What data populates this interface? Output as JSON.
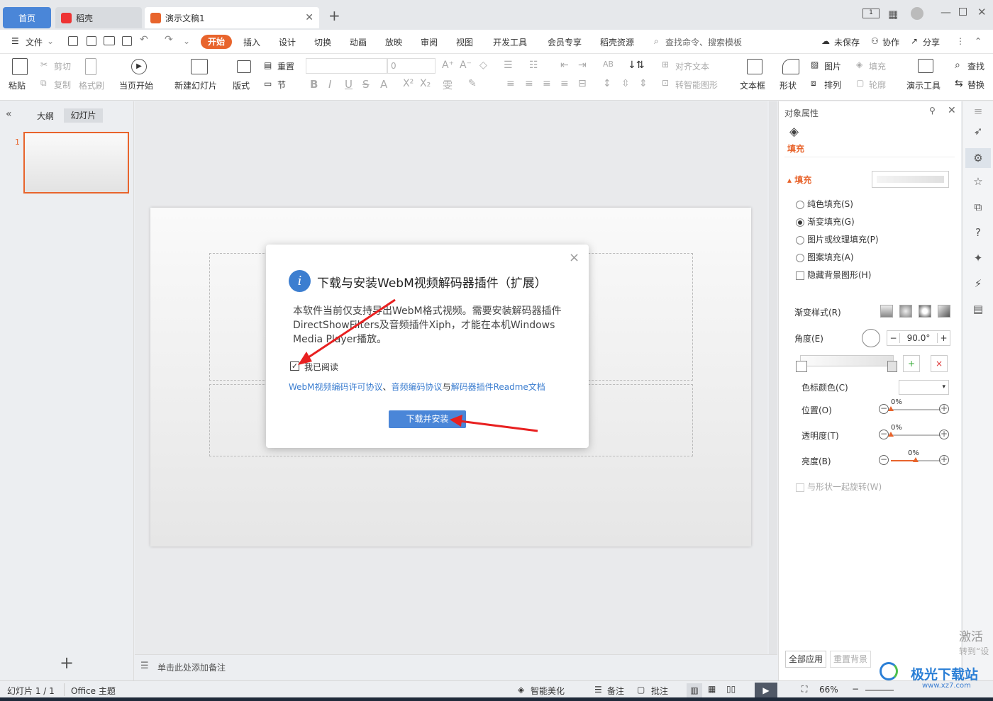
{
  "tabs": {
    "home": "首页",
    "docer": "稻壳",
    "document": "演示文稿1",
    "new_tab": "+"
  },
  "menu": {
    "file": "文件",
    "items": [
      "开始",
      "插入",
      "设计",
      "切换",
      "动画",
      "放映",
      "审阅",
      "视图",
      "开发工具",
      "会员专享",
      "稻壳资源"
    ],
    "search": "查找命令、搜索模板",
    "unsaved": "未保存",
    "collaborate": "协作",
    "share": "分享"
  },
  "toolbar": {
    "paste": "粘贴",
    "cut": "剪切",
    "copy": "复制",
    "format_painter": "格式刷",
    "from_current": "当页开始",
    "new_slide": "新建幻灯片",
    "layout": "版式",
    "reset": "重置",
    "section": "节",
    "font_size": "0",
    "align_text": "对齐文本",
    "smart_shape": "转智能图形",
    "textbox": "文本框",
    "shape": "形状",
    "picture": "图片",
    "fill": "填充",
    "arrange": "排列",
    "outline": "轮廓",
    "presenter_tools": "演示工具",
    "find": "查找",
    "replace": "替换"
  },
  "left_panel": {
    "outline_tab": "大纲",
    "slides_tab": "幻灯片",
    "slide_number": "1",
    "add": "+"
  },
  "notes": "单击此处添加备注",
  "dialog": {
    "title": "下载与安装WebM视频解码器插件（扩展）",
    "body": "本软件当前仅支持导出WebM格式视频。需要安装解码器插件DirectShowFilters及音频插件Xiph，才能在本机Windows Media Player播放。",
    "checkbox_label": "我已阅读",
    "link1": "WebM视频编码许可协议",
    "sep1": "、",
    "link2": "音频编码协议",
    "sep2": "与",
    "link3": "解码器插件Readme文档",
    "button": "下载并安装",
    "close": "×",
    "info_glyph": "i"
  },
  "right_panel": {
    "title": "对象属性",
    "fill_tab": "填充",
    "fill_section": "填充",
    "options": [
      "纯色填充(S)",
      "渐变填充(G)",
      "图片或纹理填充(P)",
      "图案填充(A)"
    ],
    "hide_bg": "隐藏背景图形(H)",
    "gradient_style": "渐变样式(R)",
    "angle": "角度(E)",
    "angle_value": "90.0°",
    "stop_color": "色标颜色(C)",
    "position": "位置(O)",
    "transparency": "透明度(T)",
    "brightness": "亮度(B)",
    "percent": "0%",
    "rotate_with_shape": "与形状一起旋转(W)",
    "apply_all": "全部应用",
    "reset_bg": "重置背景",
    "minus": "−",
    "plus": "+",
    "position_level": 0,
    "transparency_level": 0,
    "brightness_level": 0.5
  },
  "status": {
    "slide": "幻灯片 1 / 1",
    "theme": "Office 主题",
    "beautify": "智能美化",
    "notes": "备注",
    "comment": "批注",
    "zoom": "66%"
  },
  "watermark": {
    "activate": "激活",
    "goto": "转到“设",
    "logo_text": "极光下载站",
    "url": "www.xz7.com"
  },
  "colors": {
    "accent": "#e8642c",
    "blue": "#4a86d8",
    "link": "#3c7ed0"
  }
}
